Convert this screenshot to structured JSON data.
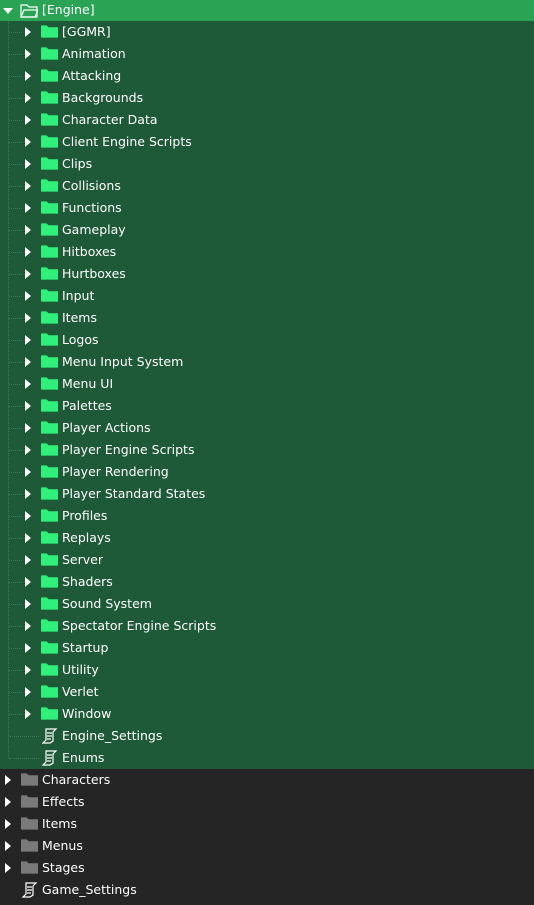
{
  "root": {
    "label": "[Engine]",
    "expanded": true,
    "icon": "folder-open-icon"
  },
  "engine_children": [
    {
      "label": "[GGMR]",
      "type": "folder"
    },
    {
      "label": "Animation",
      "type": "folder"
    },
    {
      "label": "Attacking",
      "type": "folder"
    },
    {
      "label": "Backgrounds",
      "type": "folder"
    },
    {
      "label": "Character Data",
      "type": "folder"
    },
    {
      "label": "Client Engine Scripts",
      "type": "folder"
    },
    {
      "label": "Clips",
      "type": "folder"
    },
    {
      "label": "Collisions",
      "type": "folder"
    },
    {
      "label": "Functions",
      "type": "folder"
    },
    {
      "label": "Gameplay",
      "type": "folder"
    },
    {
      "label": "Hitboxes",
      "type": "folder"
    },
    {
      "label": "Hurtboxes",
      "type": "folder"
    },
    {
      "label": "Input",
      "type": "folder"
    },
    {
      "label": "Items",
      "type": "folder"
    },
    {
      "label": "Logos",
      "type": "folder"
    },
    {
      "label": "Menu Input System",
      "type": "folder"
    },
    {
      "label": "Menu UI",
      "type": "folder"
    },
    {
      "label": "Palettes",
      "type": "folder"
    },
    {
      "label": "Player Actions",
      "type": "folder"
    },
    {
      "label": "Player Engine Scripts",
      "type": "folder"
    },
    {
      "label": "Player Rendering",
      "type": "folder"
    },
    {
      "label": "Player Standard States",
      "type": "folder"
    },
    {
      "label": "Profiles",
      "type": "folder"
    },
    {
      "label": "Replays",
      "type": "folder"
    },
    {
      "label": "Server",
      "type": "folder"
    },
    {
      "label": "Shaders",
      "type": "folder"
    },
    {
      "label": "Sound System",
      "type": "folder"
    },
    {
      "label": "Spectator Engine Scripts",
      "type": "folder"
    },
    {
      "label": "Startup",
      "type": "folder"
    },
    {
      "label": "Utility",
      "type": "folder"
    },
    {
      "label": "Verlet",
      "type": "folder"
    },
    {
      "label": "Window",
      "type": "folder"
    },
    {
      "label": "Engine_Settings",
      "type": "script"
    },
    {
      "label": "Enums",
      "type": "script"
    }
  ],
  "top_level": [
    {
      "label": "Characters",
      "type": "folder"
    },
    {
      "label": "Effects",
      "type": "folder"
    },
    {
      "label": "Items",
      "type": "folder"
    },
    {
      "label": "Menus",
      "type": "folder"
    },
    {
      "label": "Stages",
      "type": "folder"
    },
    {
      "label": "Game_Settings",
      "type": "script"
    }
  ],
  "colors": {
    "header_bg": "#2aa355",
    "engine_bg": "#1e5a38",
    "panel_bg": "#252525",
    "engine_folder": "#2ef07a",
    "gray_folder": "#7a7a7a"
  }
}
